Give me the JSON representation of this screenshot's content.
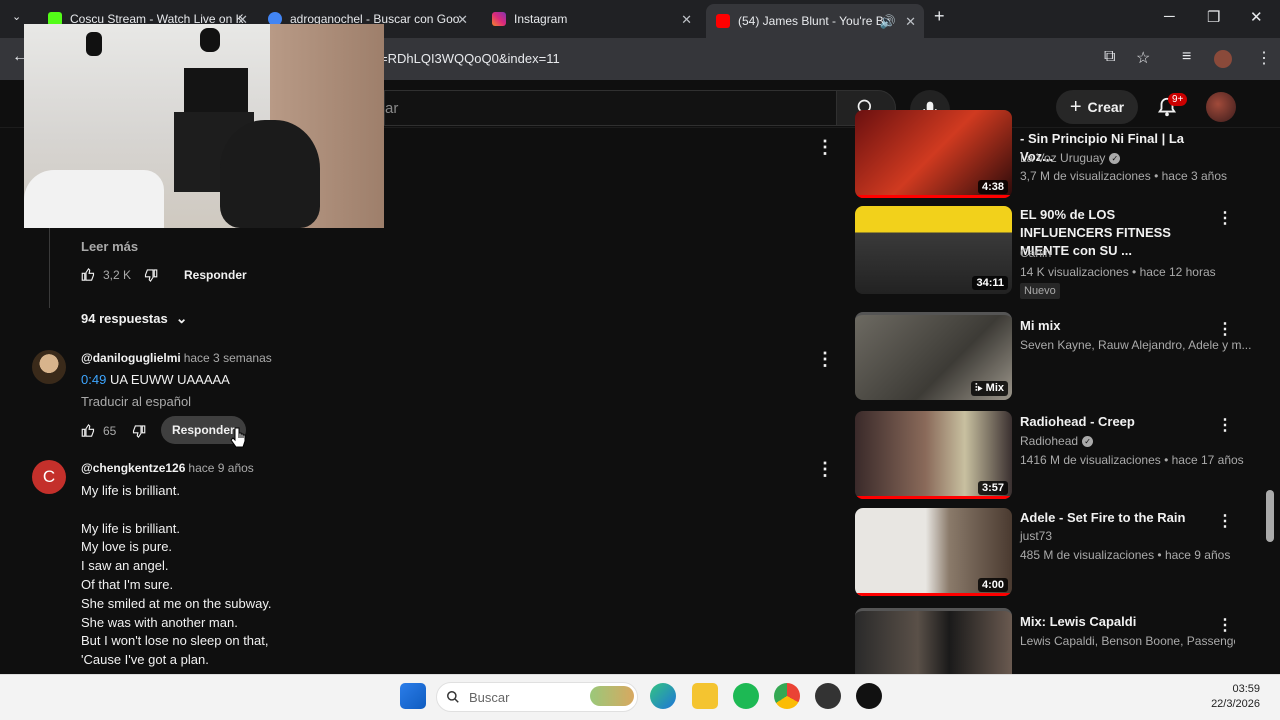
{
  "browser": {
    "tabs": [
      {
        "title": "Coscu Stream - Watch Live on K",
        "color": "#53fc18"
      },
      {
        "title": "adroganochel - Buscar con Goo",
        "color": "#4285f4"
      },
      {
        "title": "Instagram",
        "color": "#e1306c"
      },
      {
        "title": "(54) James Blunt - You're Be",
        "color": "#ff0000"
      }
    ],
    "new_tab": "+",
    "url": "=RDhLQI3WQQoQ0&index=11"
  },
  "youtube": {
    "search_placeholder": "ar",
    "create_label": "Crear",
    "notif_badge": "9+"
  },
  "comments": {
    "first": {
      "read_more": "Leer más",
      "likes": "3,2 K",
      "reply": "Responder",
      "replies_toggle": "94 respuestas"
    },
    "second": {
      "author": "@daniloguglielmi",
      "time": "hace 3 semanas",
      "timestamp": "0:49",
      "text": "UA EUWW UAAAAA",
      "translate": "Traducir al español",
      "likes": "65",
      "reply": "Responder"
    },
    "third": {
      "avatar_letter": "C",
      "author": "@chengkentze126",
      "time": "hace 9 años",
      "lines": [
        "My life is brilliant.",
        "",
        "My life is brilliant.",
        "My love is pure.",
        "I saw an angel.",
        "Of that I'm sure.",
        "She smiled at me on the subway.",
        "She was with another man.",
        "But I won't lose no sleep on that,",
        "'Cause I've got a plan."
      ]
    }
  },
  "recommendations": [
    {
      "title": "- Sin Principio Ni Final | La Voz...",
      "channel": "La Voz Uruguay",
      "verified": true,
      "meta": "3,7 M de visualizaciones • hace 3 años",
      "duration": "4:38",
      "new": ""
    },
    {
      "title": "EL 90% de LOS INFLUENCERS FITNESS MIENTE con SU ...",
      "channel": "Canin",
      "verified": false,
      "meta": "14 K visualizaciones • hace 12 horas",
      "duration": "34:11",
      "new": "Nuevo"
    },
    {
      "title": "Mi mix",
      "channel": "Seven Kayne, Rauw Alejandro, Adele y m...",
      "verified": false,
      "meta": "",
      "duration": "Mix",
      "new": ""
    },
    {
      "title": "Radiohead - Creep",
      "channel": "Radiohead",
      "verified": true,
      "meta": "1416 M de visualizaciones • hace 17 años",
      "duration": "3:57",
      "new": ""
    },
    {
      "title": "Adele - Set Fire to the Rain",
      "channel": "just73",
      "verified": false,
      "meta": "485 M de visualizaciones • hace 9 años",
      "duration": "4:00",
      "new": ""
    },
    {
      "title": "Mix: Lewis Capaldi",
      "channel": "Lewis Capaldi, Benson Boone, Passenge...",
      "verified": false,
      "meta": "",
      "duration": "",
      "new": ""
    }
  ],
  "taskbar": {
    "search_placeholder": "Buscar",
    "time": "03:59",
    "date": "22/3/2026"
  }
}
